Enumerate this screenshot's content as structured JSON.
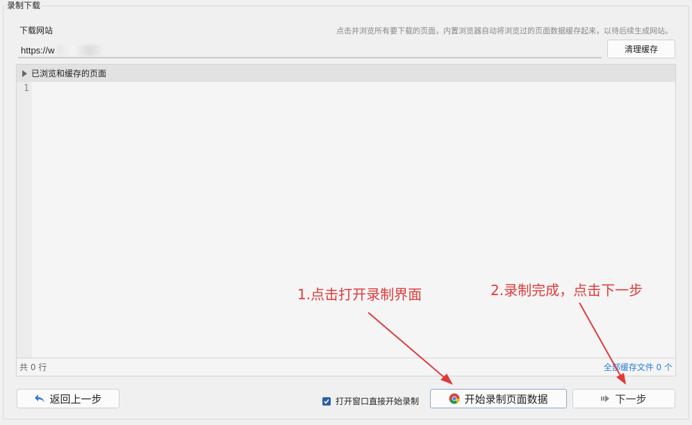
{
  "group": {
    "title": "录制下载"
  },
  "site": {
    "label": "下载网站",
    "hint": "点击并浏览所有要下载的页面，内置浏览器自动将浏览过的页面数据缓存起来，以待后续生成网站。",
    "url_value": "https://w              m/",
    "clear_label": "清理缓存"
  },
  "panel": {
    "header": "已浏览和缓存的页面",
    "line_number": "1",
    "total_lines": "共 0 行",
    "cache_files": "全部缓存文件 0 个"
  },
  "actions": {
    "back_label": "返回上一步",
    "checkbox_label": "打开窗口直接开始录制",
    "checkbox_checked": true,
    "start_label": "开始录制页面数据",
    "next_label": "下一步"
  },
  "annotations": {
    "step1": "1.点击打开录制界面",
    "step2": "2.录制完成，点击下一步",
    "color": "#e03a3a"
  }
}
